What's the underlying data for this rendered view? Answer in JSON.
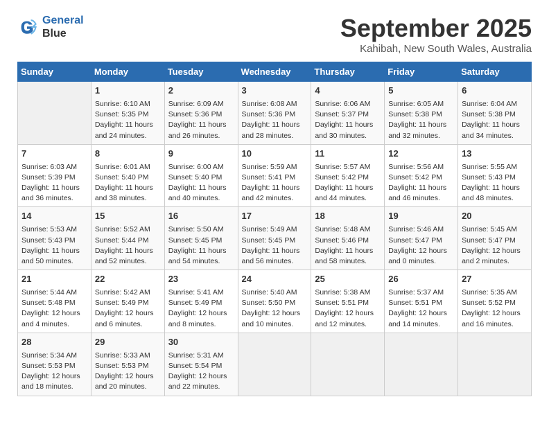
{
  "logo": {
    "line1": "General",
    "line2": "Blue"
  },
  "title": "September 2025",
  "location": "Kahibah, New South Wales, Australia",
  "days_of_week": [
    "Sunday",
    "Monday",
    "Tuesday",
    "Wednesday",
    "Thursday",
    "Friday",
    "Saturday"
  ],
  "weeks": [
    [
      {
        "day": "",
        "info": ""
      },
      {
        "day": "1",
        "info": "Sunrise: 6:10 AM\nSunset: 5:35 PM\nDaylight: 11 hours\nand 24 minutes."
      },
      {
        "day": "2",
        "info": "Sunrise: 6:09 AM\nSunset: 5:36 PM\nDaylight: 11 hours\nand 26 minutes."
      },
      {
        "day": "3",
        "info": "Sunrise: 6:08 AM\nSunset: 5:36 PM\nDaylight: 11 hours\nand 28 minutes."
      },
      {
        "day": "4",
        "info": "Sunrise: 6:06 AM\nSunset: 5:37 PM\nDaylight: 11 hours\nand 30 minutes."
      },
      {
        "day": "5",
        "info": "Sunrise: 6:05 AM\nSunset: 5:38 PM\nDaylight: 11 hours\nand 32 minutes."
      },
      {
        "day": "6",
        "info": "Sunrise: 6:04 AM\nSunset: 5:38 PM\nDaylight: 11 hours\nand 34 minutes."
      }
    ],
    [
      {
        "day": "7",
        "info": "Sunrise: 6:03 AM\nSunset: 5:39 PM\nDaylight: 11 hours\nand 36 minutes."
      },
      {
        "day": "8",
        "info": "Sunrise: 6:01 AM\nSunset: 5:40 PM\nDaylight: 11 hours\nand 38 minutes."
      },
      {
        "day": "9",
        "info": "Sunrise: 6:00 AM\nSunset: 5:40 PM\nDaylight: 11 hours\nand 40 minutes."
      },
      {
        "day": "10",
        "info": "Sunrise: 5:59 AM\nSunset: 5:41 PM\nDaylight: 11 hours\nand 42 minutes."
      },
      {
        "day": "11",
        "info": "Sunrise: 5:57 AM\nSunset: 5:42 PM\nDaylight: 11 hours\nand 44 minutes."
      },
      {
        "day": "12",
        "info": "Sunrise: 5:56 AM\nSunset: 5:42 PM\nDaylight: 11 hours\nand 46 minutes."
      },
      {
        "day": "13",
        "info": "Sunrise: 5:55 AM\nSunset: 5:43 PM\nDaylight: 11 hours\nand 48 minutes."
      }
    ],
    [
      {
        "day": "14",
        "info": "Sunrise: 5:53 AM\nSunset: 5:43 PM\nDaylight: 11 hours\nand 50 minutes."
      },
      {
        "day": "15",
        "info": "Sunrise: 5:52 AM\nSunset: 5:44 PM\nDaylight: 11 hours\nand 52 minutes."
      },
      {
        "day": "16",
        "info": "Sunrise: 5:50 AM\nSunset: 5:45 PM\nDaylight: 11 hours\nand 54 minutes."
      },
      {
        "day": "17",
        "info": "Sunrise: 5:49 AM\nSunset: 5:45 PM\nDaylight: 11 hours\nand 56 minutes."
      },
      {
        "day": "18",
        "info": "Sunrise: 5:48 AM\nSunset: 5:46 PM\nDaylight: 11 hours\nand 58 minutes."
      },
      {
        "day": "19",
        "info": "Sunrise: 5:46 AM\nSunset: 5:47 PM\nDaylight: 12 hours\nand 0 minutes."
      },
      {
        "day": "20",
        "info": "Sunrise: 5:45 AM\nSunset: 5:47 PM\nDaylight: 12 hours\nand 2 minutes."
      }
    ],
    [
      {
        "day": "21",
        "info": "Sunrise: 5:44 AM\nSunset: 5:48 PM\nDaylight: 12 hours\nand 4 minutes."
      },
      {
        "day": "22",
        "info": "Sunrise: 5:42 AM\nSunset: 5:49 PM\nDaylight: 12 hours\nand 6 minutes."
      },
      {
        "day": "23",
        "info": "Sunrise: 5:41 AM\nSunset: 5:49 PM\nDaylight: 12 hours\nand 8 minutes."
      },
      {
        "day": "24",
        "info": "Sunrise: 5:40 AM\nSunset: 5:50 PM\nDaylight: 12 hours\nand 10 minutes."
      },
      {
        "day": "25",
        "info": "Sunrise: 5:38 AM\nSunset: 5:51 PM\nDaylight: 12 hours\nand 12 minutes."
      },
      {
        "day": "26",
        "info": "Sunrise: 5:37 AM\nSunset: 5:51 PM\nDaylight: 12 hours\nand 14 minutes."
      },
      {
        "day": "27",
        "info": "Sunrise: 5:35 AM\nSunset: 5:52 PM\nDaylight: 12 hours\nand 16 minutes."
      }
    ],
    [
      {
        "day": "28",
        "info": "Sunrise: 5:34 AM\nSunset: 5:53 PM\nDaylight: 12 hours\nand 18 minutes."
      },
      {
        "day": "29",
        "info": "Sunrise: 5:33 AM\nSunset: 5:53 PM\nDaylight: 12 hours\nand 20 minutes."
      },
      {
        "day": "30",
        "info": "Sunrise: 5:31 AM\nSunset: 5:54 PM\nDaylight: 12 hours\nand 22 minutes."
      },
      {
        "day": "",
        "info": ""
      },
      {
        "day": "",
        "info": ""
      },
      {
        "day": "",
        "info": ""
      },
      {
        "day": "",
        "info": ""
      }
    ]
  ]
}
